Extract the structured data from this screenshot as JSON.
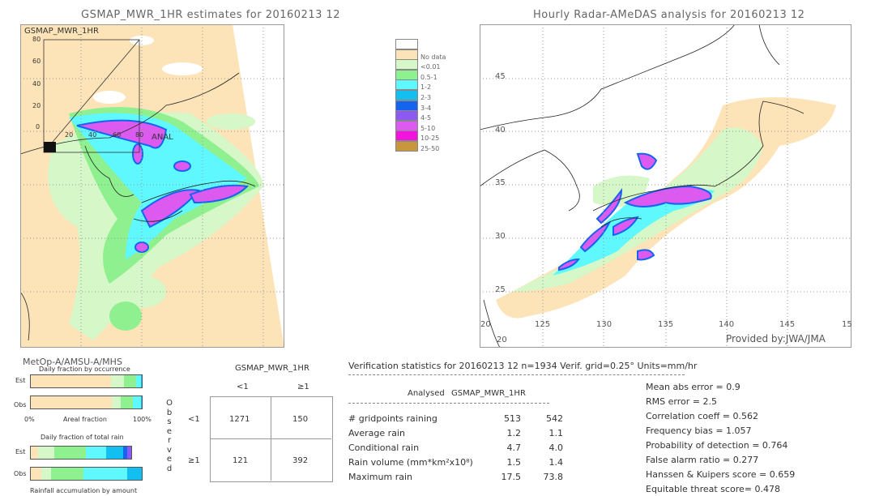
{
  "left_map": {
    "title": "GSMAP_MWR_1HR estimates for 20160213 12",
    "inset_label": "GSMAP_MWR_1HR",
    "inset_y_ticks": [
      "80",
      "60",
      "40",
      "20",
      "0"
    ],
    "inset_x_ticks": [
      "20",
      "40",
      "60",
      "80"
    ],
    "inset_x_label": "ANAL"
  },
  "legend": {
    "items": [
      {
        "label": "",
        "color": "#ffffff"
      },
      {
        "label": "No data",
        "color": "#fde4b8"
      },
      {
        "label": "<0.01",
        "color": "#d6f7c8"
      },
      {
        "label": "0.5-1",
        "color": "#8ff08f"
      },
      {
        "label": "1-2",
        "color": "#5ff8ff"
      },
      {
        "label": "2-3",
        "color": "#12bff0"
      },
      {
        "label": "3-4",
        "color": "#1464f0"
      },
      {
        "label": "4-5",
        "color": "#8c5af0"
      },
      {
        "label": "5-10",
        "color": "#dc5af0"
      },
      {
        "label": "10-25",
        "color": "#f014dc"
      },
      {
        "label": "25-50",
        "color": "#c8963c"
      }
    ]
  },
  "right_map": {
    "title": "Hourly Radar-AMeDAS analysis for 20160213 12",
    "lat_ticks": [
      "45",
      "40",
      "35",
      "30",
      "25",
      "20"
    ],
    "lon_ticks": [
      "20",
      "125",
      "130",
      "135",
      "140",
      "145",
      "15"
    ],
    "credit": "Provided by:JWA/JMA"
  },
  "fraction": {
    "sensor": "MetOp-A/AMSU-A/MHS",
    "occurrence_title": "Daily fraction by occurrence",
    "est_label": "Est",
    "obs_label": "Obs",
    "axis_left": "0%",
    "axis_mid": "Areal fraction",
    "axis_right": "100%",
    "occurrence_est": [
      72,
      12,
      11,
      4,
      1
    ],
    "occurrence_obs": [
      73,
      8,
      11,
      7,
      1
    ],
    "total_title": "Daily fraction of total rain",
    "total_est": [
      6.5,
      14.4,
      28.8,
      18.7,
      15.1,
      3.6,
      3.6
    ],
    "total_obs": [
      9.4,
      8.6,
      29.5,
      39.6,
      12.9
    ],
    "total_colors_est": [
      "#fde4b8",
      "#d6f7c8",
      "#8ff08f",
      "#5ff8ff",
      "#12bff0",
      "#1464f0",
      "#8c5af0"
    ],
    "total_colors_obs": [
      "#fde4b8",
      "#d6f7c8",
      "#8ff08f",
      "#5ff8ff",
      "#12bff0"
    ],
    "occ_colors": [
      "#fde4b8",
      "#d6f7c8",
      "#8ff08f",
      "#5ff8ff",
      "#12bff0"
    ],
    "accum_title": "Rainfall accumulation by amount"
  },
  "contingency": {
    "title": "GSMAP_MWR_1HR",
    "col_lt": "<1",
    "col_ge": "≥1",
    "row_lt": "<1",
    "row_ge": "≥1",
    "observed_letters": [
      "O",
      "b",
      "s",
      "e",
      "r",
      "v",
      "e",
      "d"
    ],
    "cells": [
      [
        "1271",
        "150"
      ],
      [
        "121",
        "392"
      ]
    ]
  },
  "stats": {
    "header": "Verification statistics for 20160213 12  n=1934  Verif. grid=0.25°  Units=mm/hr",
    "col_analysed": "Analysed",
    "col_gsmap": "GSMAP_MWR_1HR",
    "rows": [
      {
        "label": "# gridpoints raining",
        "analysed": "513",
        "gsmap": "542"
      },
      {
        "label": "Average rain",
        "analysed": "1.2",
        "gsmap": "1.1"
      },
      {
        "label": "Conditional rain",
        "analysed": "4.7",
        "gsmap": "4.0"
      },
      {
        "label": "Rain volume (mm*km²x10⁸)",
        "analysed": "1.5",
        "gsmap": "1.4"
      },
      {
        "label": "Maximum rain",
        "analysed": "17.5",
        "gsmap": "73.8"
      }
    ],
    "scores": [
      "Mean abs error = 0.9",
      "RMS error = 2.5",
      "Correlation coeff = 0.562",
      "Frequency bias = 1.057",
      "Probability of detection = 0.764",
      "False alarm ratio = 0.277",
      "Hanssen & Kuipers score = 0.659",
      "Equitable threat score= 0.478"
    ]
  }
}
